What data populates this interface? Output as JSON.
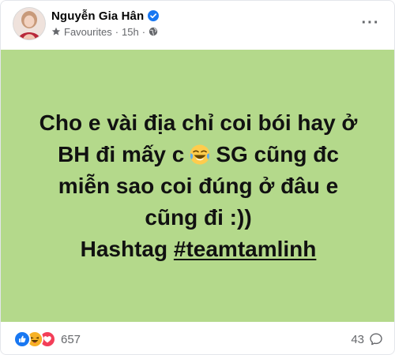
{
  "post": {
    "author": {
      "name": "Nguyễn Gia Hân",
      "verified": true
    },
    "meta": {
      "list_label": "Favourites",
      "separator": "·",
      "time": "15h",
      "audience_icon": "globe-icon"
    },
    "more_icon": "more-options-icon",
    "background_color": "#b4d98b",
    "text_lines": [
      "Cho e vài địa chỉ coi bói hay ở",
      "BH đi mấy c",
      "SG cũng đc",
      "miễn sao coi đúng ở đâu e",
      "cũng đi :))",
      "Hashtag ",
      "#teamtamlinh"
    ],
    "inline_emoji": "laughing-crying-emoji",
    "reactions": {
      "icons": [
        "like-reaction-icon",
        "haha-reaction-icon",
        "love-reaction-icon"
      ],
      "count": "657"
    },
    "comments": {
      "count": "43",
      "icon": "comment-icon"
    }
  },
  "colors": {
    "like_blue": "#1877f2",
    "haha_yellow": "#f7b125",
    "love_red": "#f33e58",
    "verified_blue": "#1877f2",
    "secondary_text": "#65676b"
  }
}
